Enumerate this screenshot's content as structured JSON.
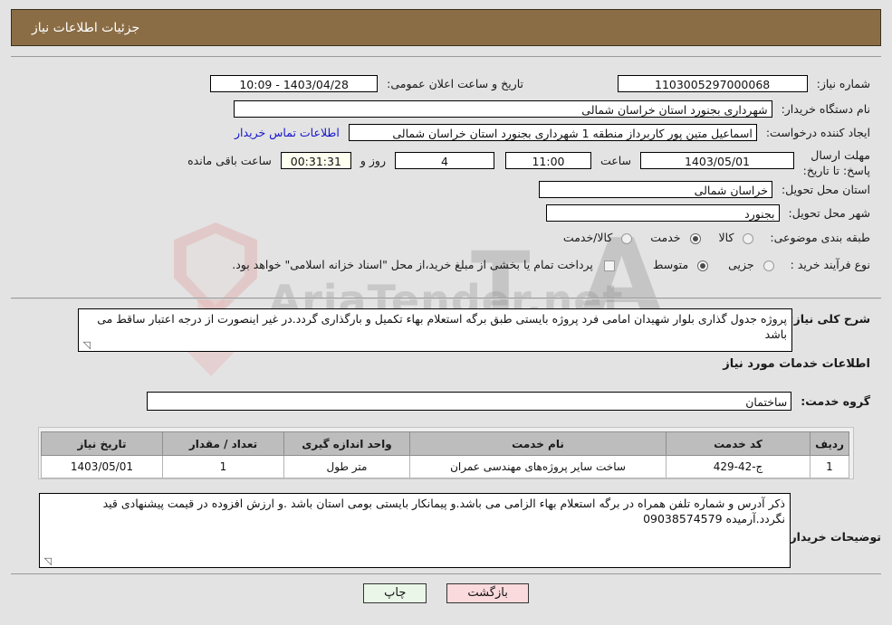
{
  "header": {
    "title": "جزئیات اطلاعات نیاز"
  },
  "watermark": {
    "text": "AriaTender.net"
  },
  "fields": {
    "need_number_label": "شماره نیاز:",
    "need_number_value": "1103005297000068",
    "public_announce_label": "تاریخ و ساعت اعلان عمومی:",
    "public_announce_value": "1403/04/28 - 10:09",
    "buyer_org_label": "نام دستگاه خریدار:",
    "buyer_org_value": "شهرداری بجنورد استان خراسان شمالی",
    "requester_label": "ایجاد کننده درخواست:",
    "requester_value": "اسماعیل متین پور کاربرداز منطقه 1 شهرداری بجنورد استان خراسان شمالی",
    "buyer_contact_link": "اطلاعات تماس خریدار",
    "deadline_label": "مهلت ارسال پاسخ: تا تاریخ:",
    "deadline_date": "1403/05/01",
    "hour_label": "ساعت",
    "deadline_time": "11:00",
    "days_remaining": "4",
    "days_label": "روز و",
    "countdown": "00:31:31",
    "hours_remaining_label": "ساعت باقی مانده",
    "province_label": "استان محل تحویل:",
    "province_value": "خراسان شمالی",
    "city_label": "شهر محل تحویل:",
    "city_value": "بجنورد",
    "category_label": "طبقه بندی موضوعی:",
    "process_label": "نوع فرآیند خرید :",
    "treasury_note": "پرداخت تمام یا بخشی از مبلغ خرید،از محل \"اسناد خزانه اسلامی\" خواهد بود."
  },
  "category_options": [
    {
      "label": "کالا",
      "selected": false
    },
    {
      "label": "خدمت",
      "selected": true
    },
    {
      "label": "کالا/خدمت",
      "selected": false
    }
  ],
  "process_options": [
    {
      "label": "جزیی",
      "selected": false
    },
    {
      "label": "متوسط",
      "selected": true
    }
  ],
  "description": {
    "label": "شرح کلی نیاز:",
    "value": "پروژه جدول گذاری بلوار شهیدان امامی فرد پروژه بایستی طبق برگه استعلام بهاء تکمیل و بارگذاری گردد.در غیر اینصورت از درجه اعتبار ساقط می باشد"
  },
  "services_section": {
    "heading": "اطلاعات خدمات مورد نیاز",
    "group_label": "گروه خدمت:",
    "group_value": "ساختمان"
  },
  "table": {
    "columns": [
      "ردیف",
      "کد خدمت",
      "نام خدمت",
      "واحد اندازه گیری",
      "تعداد / مقدار",
      "تاریخ نیاز"
    ],
    "rows": [
      {
        "row": "1",
        "code": "ج-42-429",
        "name": "ساخت سایر پروژه‌های مهندسی عمران",
        "unit": "متر طول",
        "qty": "1",
        "date": "1403/05/01"
      }
    ]
  },
  "buyer_notes": {
    "label": "توضیحات خریدار:",
    "value": "ذکر آدرس و شماره تلفن همراه در برگه استعلام بهاء الزامی می باشد.و پیمانکار بایستی بومی استان باشد .و ارزش افزوده در قیمت پیشنهادی قید نگردد.آرمیده 09038574579"
  },
  "buttons": {
    "print": "چاپ",
    "back": "بازگشت"
  }
}
